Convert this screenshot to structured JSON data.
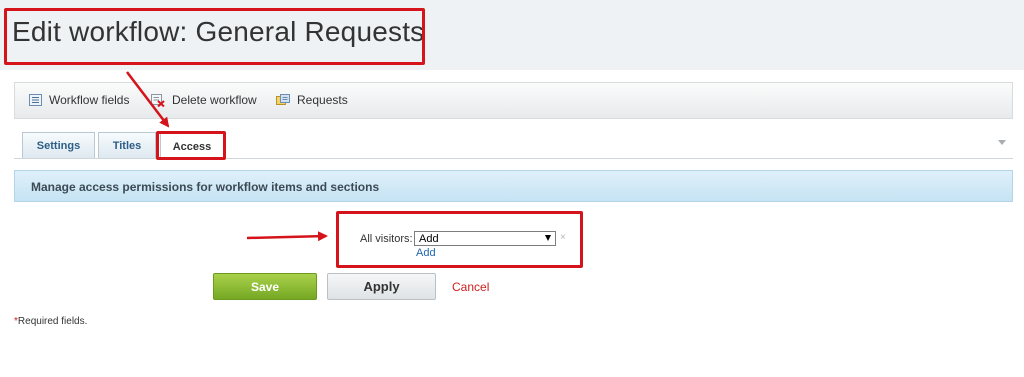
{
  "page": {
    "title": "Edit workflow: General Requests"
  },
  "toolbar": {
    "items": [
      {
        "label": "Workflow fields",
        "icon": "list-icon"
      },
      {
        "label": "Delete workflow",
        "icon": "delete-icon"
      },
      {
        "label": "Requests",
        "icon": "requests-icon"
      }
    ]
  },
  "tabs": [
    {
      "label": "Settings",
      "active": false
    },
    {
      "label": "Titles",
      "active": false
    },
    {
      "label": "Access",
      "active": true
    }
  ],
  "section": {
    "heading": "Manage access permissions for workflow items and sections"
  },
  "permissions": {
    "label": "All visitors:",
    "selected": "Add",
    "remove_glyph": "×",
    "add_link": "Add"
  },
  "buttons": {
    "save": "Save",
    "apply": "Apply",
    "cancel": "Cancel"
  },
  "footer": {
    "required_star": "*",
    "required_text": "Required fields."
  },
  "colors": {
    "annotation_red": "#d4141a",
    "save_green": "#8bbd32",
    "section_blue": "#d2eaf7",
    "link_blue": "#2067b0",
    "cancel_red": "#cc1f1f"
  }
}
